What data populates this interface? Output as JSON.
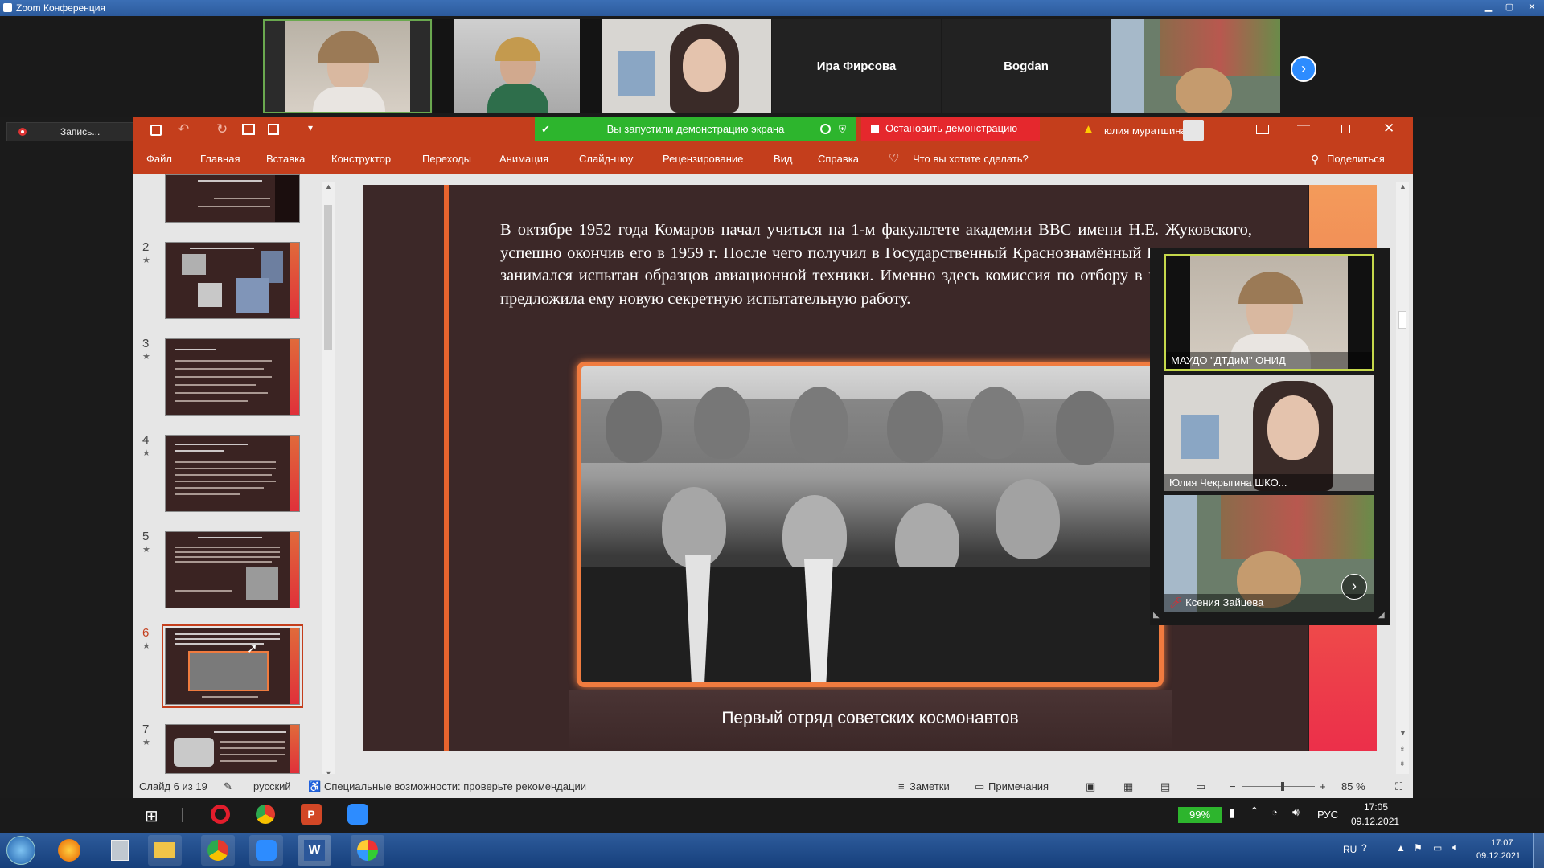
{
  "zoom": {
    "title": "Zoom Конференция",
    "record_label": "Запись...",
    "gallery": [
      {
        "name": ""
      },
      {
        "name": ""
      },
      {
        "name": ""
      },
      {
        "name": "Ира Фирсова"
      },
      {
        "name": "Bogdan"
      },
      {
        "name": ""
      }
    ],
    "share_notice": "Вы запустили демонстрацию экрана",
    "stop_share": "Остановить демонстрацию",
    "side_videos": [
      {
        "name": "МАУДО \"ДТДиМ\" ОНИД"
      },
      {
        "name": "Юлия Чекрыгина ШКО..."
      },
      {
        "name": "Ксения Зайцева"
      }
    ]
  },
  "ppt": {
    "user": "юлия муратшина",
    "menu": [
      "Файл",
      "Главная",
      "Вставка",
      "Конструктор",
      "Переходы",
      "Анимация",
      "Слайд-шоу",
      "Рецензирование",
      "Вид",
      "Справка"
    ],
    "tell_me": "Что вы хотите сделать?",
    "share": "Поделиться",
    "thumbs": [
      {
        "num": "",
        "star": ""
      },
      {
        "num": "2",
        "star": "★"
      },
      {
        "num": "3",
        "star": "★"
      },
      {
        "num": "4",
        "star": "★"
      },
      {
        "num": "5",
        "star": "★"
      },
      {
        "num": "6",
        "star": "★"
      },
      {
        "num": "7",
        "star": "★"
      }
    ],
    "slide": {
      "text": "В октябре 1952 года Комаров начал учиться на 1-м факультете академии ВВС имени Н.Е. Жуковского, успешно окончив его в 1959 г. После чего получил в Государственный Краснознамённый НИИ ВВС, где занимался испытан образцов авиационной техники. Именно здесь комиссия по отбору в п космонавтов предложила ему новую секретную испытательную работу.",
      "caption": "Первый отряд советских космонавтов"
    },
    "status": {
      "slide_of": "Слайд 6 из 19",
      "language": "русский",
      "accessibility": "Специальные возможности: проверьте рекомендации",
      "notes": "Заметки",
      "comments": "Примечания",
      "zoom": "85 %"
    }
  },
  "taskbar": {
    "battery": "99%",
    "lang": "РУС",
    "time": "17:05",
    "date": "09.12.2021",
    "lang2": "RU",
    "time2": "17:07",
    "date2": "09.12.2021"
  },
  "colors": {
    "ppt_red": "#c43e1c",
    "zoom_green": "#2db52d",
    "zoom_stop": "#e5282d",
    "slide_bg": "#3c2828",
    "accent_orange": "#f07b3f"
  }
}
